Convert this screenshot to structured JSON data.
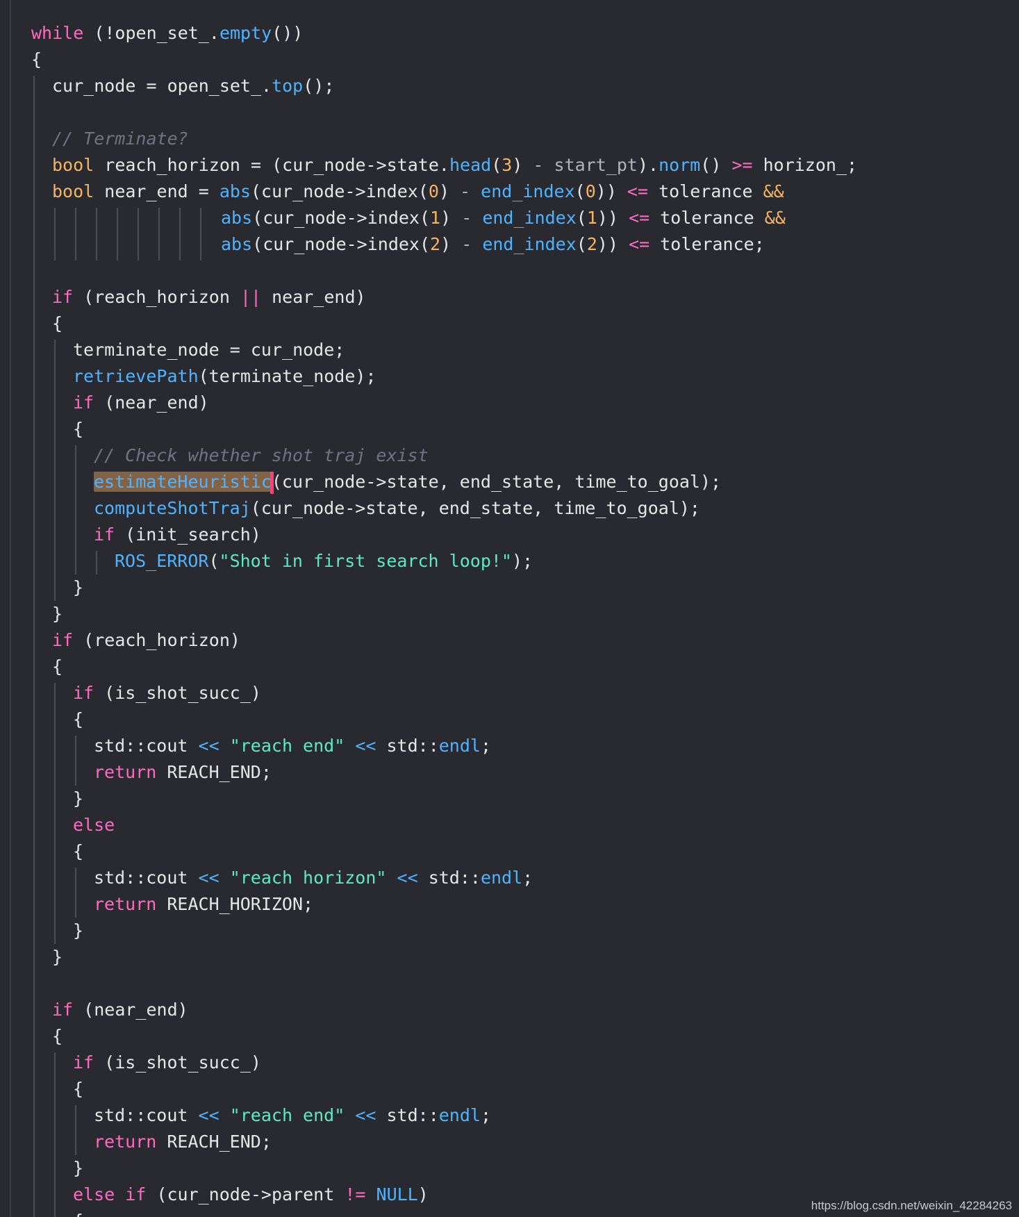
{
  "editor": {
    "colors": {
      "background": "#282a2f",
      "keyword": "#ff6ac1",
      "type": "#f5b461",
      "function": "#4fb3ff",
      "string": "#5ee9c4",
      "number": "#f5b461",
      "comment": "#6f7480",
      "plain": "#e6e6e6",
      "caret": "#ff3d7f",
      "selection": "#b48250"
    },
    "lines": [
      {
        "indent": 0,
        "tokens": [
          {
            "t": "while",
            "k": "kw"
          },
          {
            "t": " (!open_set_."
          },
          {
            "t": "empty",
            "k": "fn"
          },
          {
            "t": "())"
          }
        ]
      },
      {
        "indent": 0,
        "tokens": [
          {
            "t": "{"
          }
        ]
      },
      {
        "indent": 1,
        "tokens": [
          {
            "t": "cur_node = open_set_."
          },
          {
            "t": "top",
            "k": "fn"
          },
          {
            "t": "();"
          }
        ]
      },
      {
        "indent": 1,
        "tokens": []
      },
      {
        "indent": 1,
        "tokens": [
          {
            "t": "// Terminate?",
            "k": "cmt"
          }
        ]
      },
      {
        "indent": 1,
        "tokens": [
          {
            "t": "bool",
            "k": "type"
          },
          {
            "t": " reach_horizon = (cur_node->state."
          },
          {
            "t": "head",
            "k": "fn"
          },
          {
            "t": "("
          },
          {
            "t": "3",
            "k": "num"
          },
          {
            "t": ") "
          },
          {
            "t": "-",
            "k": "muted"
          },
          {
            "t": " start_pt",
            "k": "muted"
          },
          {
            "t": ")."
          },
          {
            "t": "norm",
            "k": "fn"
          },
          {
            "t": "() "
          },
          {
            "t": ">=",
            "k": "op"
          },
          {
            "t": " horizon_;"
          }
        ]
      },
      {
        "indent": 1,
        "tokens": [
          {
            "t": "bool",
            "k": "type"
          },
          {
            "t": " near_end = "
          },
          {
            "t": "abs",
            "k": "fn"
          },
          {
            "t": "(cur_node->index("
          },
          {
            "t": "0",
            "k": "num"
          },
          {
            "t": ") "
          },
          {
            "t": "-",
            "k": "muted"
          },
          {
            "t": " "
          },
          {
            "t": "end_index",
            "k": "fn"
          },
          {
            "t": "("
          },
          {
            "t": "0",
            "k": "num"
          },
          {
            "t": ")) "
          },
          {
            "t": "<=",
            "k": "op"
          },
          {
            "t": " tolerance "
          },
          {
            "t": "&&",
            "k": "type"
          }
        ]
      },
      {
        "indent": 1,
        "cont": true,
        "tokens": [
          {
            "t": "abs",
            "k": "fn"
          },
          {
            "t": "(cur_node->index("
          },
          {
            "t": "1",
            "k": "num"
          },
          {
            "t": ") "
          },
          {
            "t": "-",
            "k": "muted"
          },
          {
            "t": " "
          },
          {
            "t": "end_index",
            "k": "fn"
          },
          {
            "t": "("
          },
          {
            "t": "1",
            "k": "num"
          },
          {
            "t": ")) "
          },
          {
            "t": "<=",
            "k": "op"
          },
          {
            "t": " tolerance "
          },
          {
            "t": "&&",
            "k": "type"
          }
        ]
      },
      {
        "indent": 1,
        "cont": true,
        "tokens": [
          {
            "t": "abs",
            "k": "fn"
          },
          {
            "t": "(cur_node->index("
          },
          {
            "t": "2",
            "k": "num"
          },
          {
            "t": ") "
          },
          {
            "t": "-",
            "k": "muted"
          },
          {
            "t": " "
          },
          {
            "t": "end_index",
            "k": "fn"
          },
          {
            "t": "("
          },
          {
            "t": "2",
            "k": "num"
          },
          {
            "t": ")) "
          },
          {
            "t": "<=",
            "k": "op"
          },
          {
            "t": " tolerance;"
          }
        ]
      },
      {
        "indent": 1,
        "tokens": []
      },
      {
        "indent": 1,
        "tokens": [
          {
            "t": "if",
            "k": "kw"
          },
          {
            "t": " (reach_horizon "
          },
          {
            "t": "||",
            "k": "op"
          },
          {
            "t": " near_end)"
          }
        ]
      },
      {
        "indent": 1,
        "tokens": [
          {
            "t": "{"
          }
        ]
      },
      {
        "indent": 2,
        "tokens": [
          {
            "t": "terminate_node = cur_node;"
          }
        ]
      },
      {
        "indent": 2,
        "tokens": [
          {
            "t": "retrievePath",
            "k": "fn"
          },
          {
            "t": "(terminate_node);"
          }
        ]
      },
      {
        "indent": 2,
        "tokens": [
          {
            "t": "if",
            "k": "kw"
          },
          {
            "t": " (near_end)"
          }
        ]
      },
      {
        "indent": 2,
        "tokens": [
          {
            "t": "{"
          }
        ]
      },
      {
        "indent": 3,
        "tokens": [
          {
            "t": "// Check whether shot traj exist",
            "k": "cmt"
          }
        ]
      },
      {
        "indent": 3,
        "tokens": [
          {
            "t": "estimateHeuristic",
            "k": "fn",
            "sel": true
          },
          {
            "caret": true
          },
          {
            "t": "(cur_node->state, end_state, time_to_goal);"
          }
        ]
      },
      {
        "indent": 3,
        "tokens": [
          {
            "t": "computeShotTraj",
            "k": "fn"
          },
          {
            "t": "(cur_node->state, end_state, time_to_goal);"
          }
        ]
      },
      {
        "indent": 3,
        "tokens": [
          {
            "t": "if",
            "k": "kw"
          },
          {
            "t": " (init_search)"
          }
        ]
      },
      {
        "indent": 4,
        "tokens": [
          {
            "t": "ROS_ERROR",
            "k": "fn"
          },
          {
            "t": "("
          },
          {
            "t": "\"Shot in first search loop!\"",
            "k": "str"
          },
          {
            "t": ");"
          }
        ]
      },
      {
        "indent": 2,
        "tokens": [
          {
            "t": "}"
          }
        ]
      },
      {
        "indent": 1,
        "tokens": [
          {
            "t": "}"
          }
        ]
      },
      {
        "indent": 1,
        "tokens": [
          {
            "t": "if",
            "k": "kw"
          },
          {
            "t": " (reach_horizon)"
          }
        ]
      },
      {
        "indent": 1,
        "tokens": [
          {
            "t": "{"
          }
        ]
      },
      {
        "indent": 2,
        "tokens": [
          {
            "t": "if",
            "k": "kw"
          },
          {
            "t": " (is_shot_succ_)"
          }
        ]
      },
      {
        "indent": 2,
        "tokens": [
          {
            "t": "{"
          }
        ]
      },
      {
        "indent": 3,
        "tokens": [
          {
            "t": "std::cout "
          },
          {
            "t": "<<",
            "k": "fn"
          },
          {
            "t": " "
          },
          {
            "t": "\"reach end\"",
            "k": "str"
          },
          {
            "t": " "
          },
          {
            "t": "<<",
            "k": "fn"
          },
          {
            "t": " std::"
          },
          {
            "t": "endl",
            "k": "fn"
          },
          {
            "t": ";"
          }
        ]
      },
      {
        "indent": 3,
        "tokens": [
          {
            "t": "return",
            "k": "kw"
          },
          {
            "t": " REACH_END;"
          }
        ]
      },
      {
        "indent": 2,
        "tokens": [
          {
            "t": "}"
          }
        ]
      },
      {
        "indent": 2,
        "tokens": [
          {
            "t": "else",
            "k": "kw"
          }
        ]
      },
      {
        "indent": 2,
        "tokens": [
          {
            "t": "{"
          }
        ]
      },
      {
        "indent": 3,
        "tokens": [
          {
            "t": "std::cout "
          },
          {
            "t": "<<",
            "k": "fn"
          },
          {
            "t": " "
          },
          {
            "t": "\"reach horizon\"",
            "k": "str"
          },
          {
            "t": " "
          },
          {
            "t": "<<",
            "k": "fn"
          },
          {
            "t": " std::"
          },
          {
            "t": "endl",
            "k": "fn"
          },
          {
            "t": ";"
          }
        ]
      },
      {
        "indent": 3,
        "tokens": [
          {
            "t": "return",
            "k": "kw"
          },
          {
            "t": " REACH_HORIZON;"
          }
        ]
      },
      {
        "indent": 2,
        "tokens": [
          {
            "t": "}"
          }
        ]
      },
      {
        "indent": 1,
        "tokens": [
          {
            "t": "}"
          }
        ]
      },
      {
        "indent": 1,
        "tokens": []
      },
      {
        "indent": 1,
        "tokens": [
          {
            "t": "if",
            "k": "kw"
          },
          {
            "t": " (near_end)"
          }
        ]
      },
      {
        "indent": 1,
        "tokens": [
          {
            "t": "{"
          }
        ]
      },
      {
        "indent": 2,
        "tokens": [
          {
            "t": "if",
            "k": "kw"
          },
          {
            "t": " (is_shot_succ_)"
          }
        ]
      },
      {
        "indent": 2,
        "tokens": [
          {
            "t": "{"
          }
        ]
      },
      {
        "indent": 3,
        "tokens": [
          {
            "t": "std::cout "
          },
          {
            "t": "<<",
            "k": "fn"
          },
          {
            "t": " "
          },
          {
            "t": "\"reach end\"",
            "k": "str"
          },
          {
            "t": " "
          },
          {
            "t": "<<",
            "k": "fn"
          },
          {
            "t": " std::"
          },
          {
            "t": "endl",
            "k": "fn"
          },
          {
            "t": ";"
          }
        ]
      },
      {
        "indent": 3,
        "tokens": [
          {
            "t": "return",
            "k": "kw"
          },
          {
            "t": " REACH_END;"
          }
        ]
      },
      {
        "indent": 2,
        "tokens": [
          {
            "t": "}"
          }
        ]
      },
      {
        "indent": 2,
        "tokens": [
          {
            "t": "else if",
            "k": "kw"
          },
          {
            "t": " (cur_node->parent "
          },
          {
            "t": "!=",
            "k": "op"
          },
          {
            "t": " "
          },
          {
            "t": "NULL",
            "k": "fn"
          },
          {
            "t": ")"
          }
        ]
      },
      {
        "indent": 2,
        "tokens": [
          {
            "t": "{"
          }
        ]
      }
    ]
  },
  "watermark": {
    "text": "https://blog.csdn.net/weixin_42284263"
  }
}
